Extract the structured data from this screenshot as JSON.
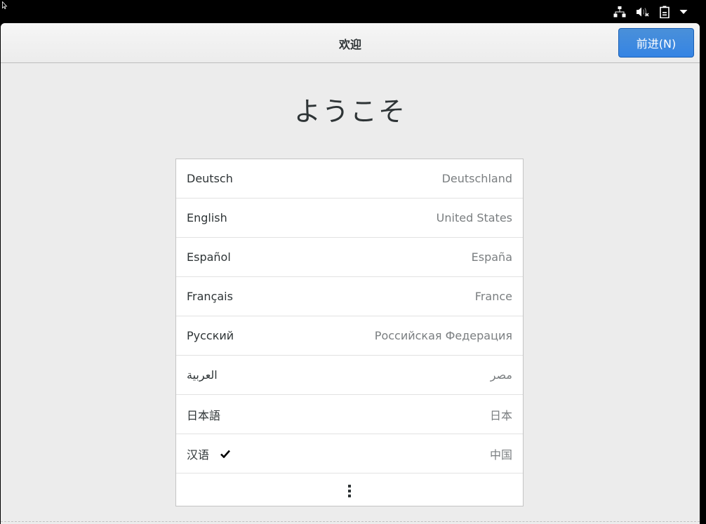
{
  "header": {
    "title": "欢迎",
    "next_label": "前进(N)"
  },
  "welcome": {
    "title": "ようこそ"
  },
  "status_icons": [
    "network-icon",
    "audio-muted-icon",
    "battery-icon",
    "chevron-down-icon"
  ],
  "languages": [
    {
      "name": "Deutsch",
      "country": "Deutschland",
      "selected": false
    },
    {
      "name": "English",
      "country": "United States",
      "selected": false
    },
    {
      "name": "Español",
      "country": "España",
      "selected": false
    },
    {
      "name": "Français",
      "country": "France",
      "selected": false
    },
    {
      "name": "Русский",
      "country": "Российская Федерация",
      "selected": false
    },
    {
      "name": "العربية",
      "country": "مصر",
      "selected": false
    },
    {
      "name": "日本語",
      "country": "日本",
      "selected": false
    },
    {
      "name": "汉语",
      "country": "中国",
      "selected": true
    }
  ],
  "colors": {
    "accent": "#3584e4",
    "background": "#ececec",
    "topbar": "#000000"
  }
}
